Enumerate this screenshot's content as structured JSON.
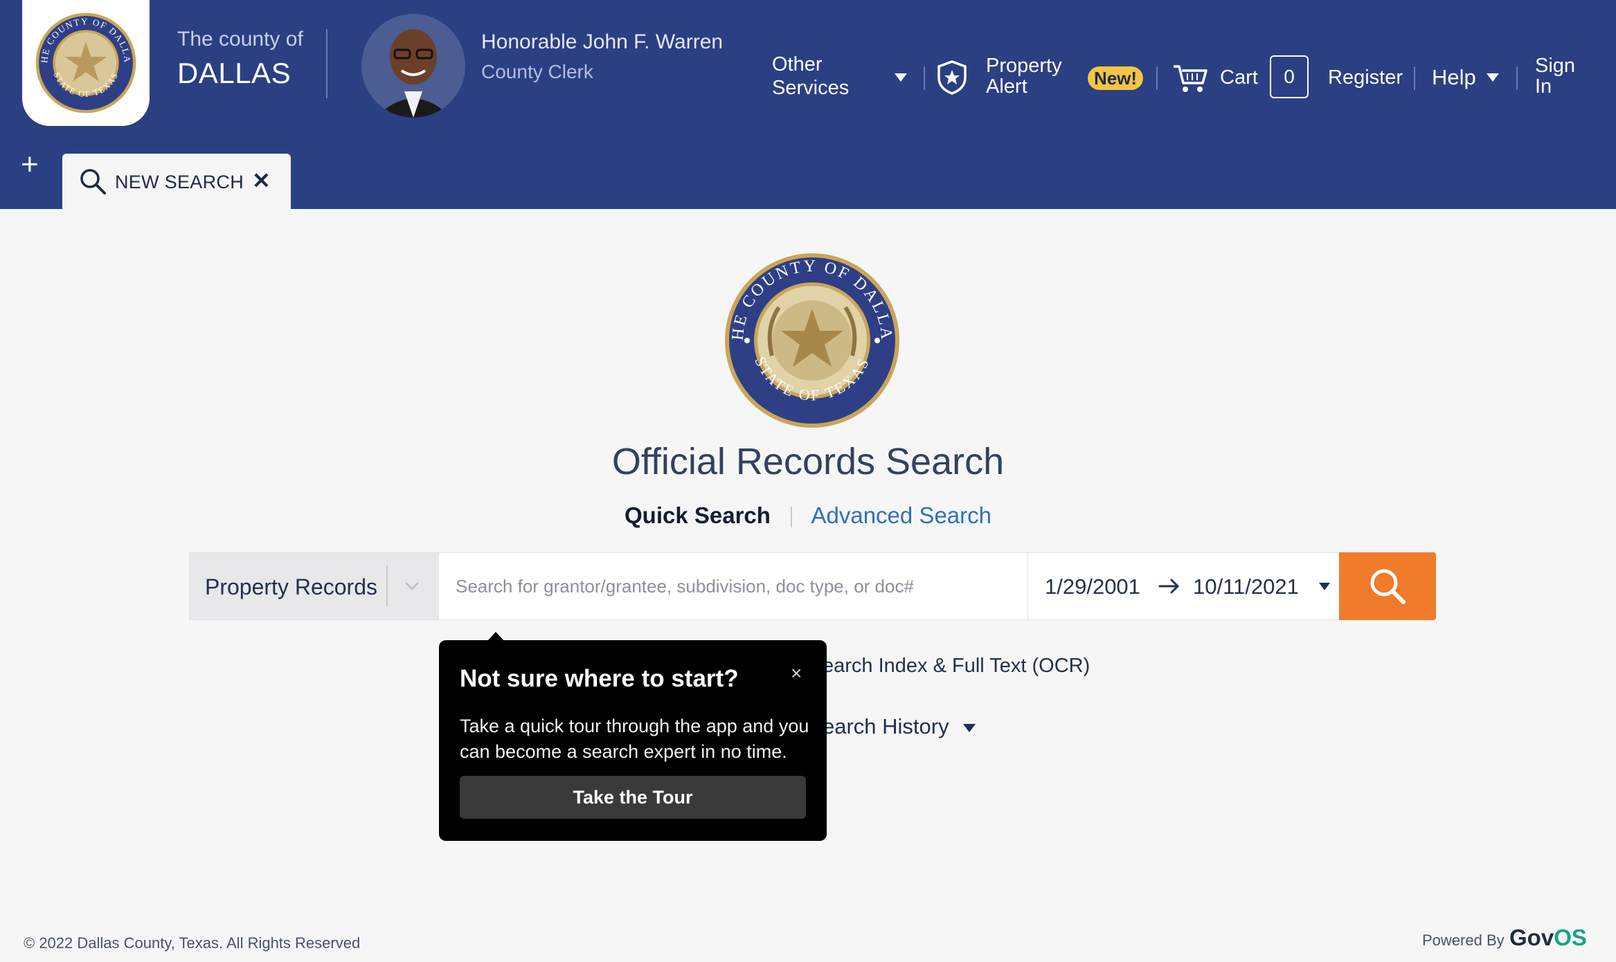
{
  "header": {
    "county_prefix": "The county of",
    "county_name": "DALLAS",
    "clerk_name": "Honorable John F. Warren",
    "clerk_title": "County Clerk",
    "seal_text_top": "THE COUNTY OF DALLAS",
    "seal_text_bottom": "STATE OF TEXAS"
  },
  "nav": {
    "other_services_line1": "Other",
    "other_services_line2": "Services",
    "property_alert_line1": "Property",
    "property_alert_line2": "Alert",
    "new_badge": "New!",
    "cart_label": "Cart",
    "cart_count": "0",
    "register": "Register",
    "help": "Help",
    "sign_in_line1": "Sign",
    "sign_in_line2": "In"
  },
  "tabs": {
    "add_icon": "+",
    "active_tab_label": "NEW SEARCH",
    "close_icon": "✕"
  },
  "main": {
    "title": "Official Records Search",
    "mode_quick": "Quick Search",
    "mode_advanced": "Advanced Search",
    "department": "Property Records",
    "search_placeholder": "Search for grantor/grantee, subdivision, doc type, or doc#",
    "date_from": "1/29/2001",
    "date_to": "10/11/2021",
    "option_ocr": "earch Index & Full Text (OCR)",
    "option_history": "earch History"
  },
  "tour": {
    "title": "Not sure where to start?",
    "body": "Take a quick tour through the app and you can become a search expert in no time.",
    "button": "Take the Tour",
    "close": "×"
  },
  "footer": {
    "copyright": "© 2022 Dallas County, Texas. All Rights Reserved",
    "powered_by": "Powered By",
    "brand_gov": "Gov",
    "brand_os": "OS"
  },
  "colors": {
    "header_bg": "#2b3f83",
    "accent_orange": "#f07b2a",
    "link_blue": "#2f6fba",
    "badge_yellow": "#f4c542"
  },
  "icons": [
    "county-seal-icon",
    "caret-down-icon",
    "shield-star-icon",
    "cart-icon",
    "search-icon",
    "close-icon",
    "plus-icon",
    "arrow-right-icon",
    "chevron-down-icon"
  ]
}
